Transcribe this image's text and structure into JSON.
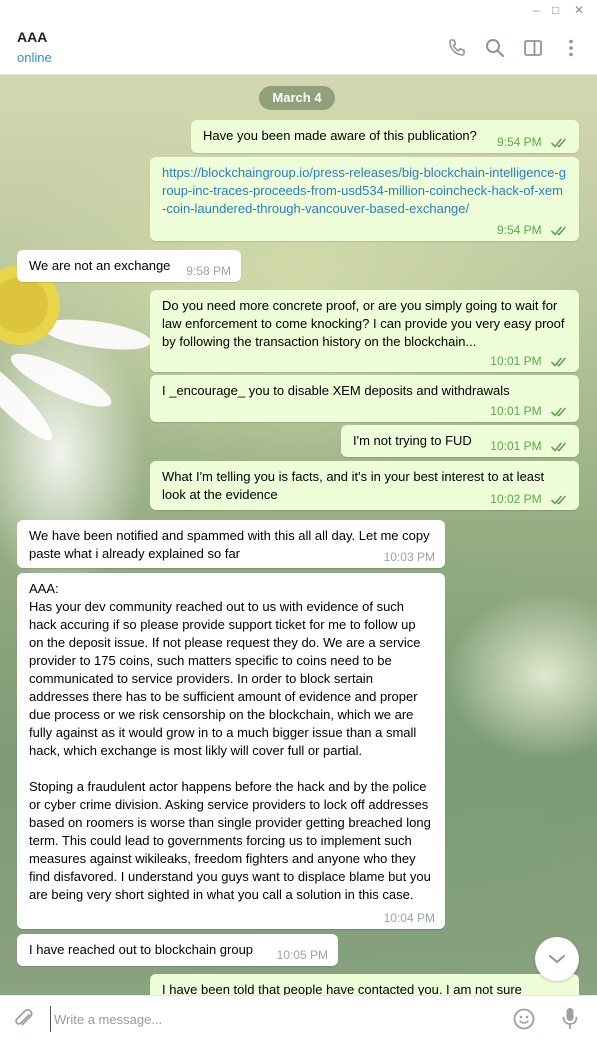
{
  "window": {
    "minimize": "–",
    "maximize": "□",
    "close": "✕"
  },
  "header": {
    "title": "AAA",
    "status": "online",
    "icons": [
      "phone-icon",
      "search-icon",
      "sidebar-toggle-icon",
      "more-icon"
    ]
  },
  "date_separator": "March 4",
  "messages": [
    {
      "from": "me",
      "text": "Have you been made aware of this publication?",
      "time": "9:54 PM",
      "read": true
    },
    {
      "from": "me",
      "text": "https://blockchaingroup.io/press-releases/big-blockchain-intelligence-group-inc-traces-proceeds-from-usd534-million-coincheck-hack-of-xem-coin-laundered-through-vancouver-based-exchange/",
      "time": "9:54 PM",
      "read": true,
      "is_link": true
    },
    {
      "from": "them",
      "text": "We are not an exchange",
      "time": "9:58 PM"
    },
    {
      "from": "me",
      "text": "Do you need more concrete proof, or are you simply going to wait for law enforcement to come knocking? I can provide you very easy proof by following the transaction history on the blockchain...",
      "time": "10:01 PM",
      "read": true
    },
    {
      "from": "me",
      "text": "I _encourage_ you to disable XEM deposits and withdrawals",
      "time": "10:01 PM",
      "read": true
    },
    {
      "from": "me",
      "text": "I'm not trying to FUD",
      "time": "10:01 PM",
      "read": true
    },
    {
      "from": "me",
      "text": "What I'm telling you is facts, and it's in your best interest to at least look at the evidence",
      "time": "10:02 PM",
      "read": true
    },
    {
      "from": "them",
      "text": "We have been notified and spammed with this all all day. Let me copy paste what i already explained so far",
      "time": "10:03 PM"
    },
    {
      "from": "them",
      "text": "AAA:\nHas your dev community reached out to us with evidence of such hack accuring if so please provide support ticket for me to follow up on the deposit issue. If not please request they do. We are a service provider to 175 coins, such matters specific to coins need to be communicated to service providers. In order to block sertain addresses there has to be sufficient amount of evidence and proper due process or we risk censorship on the blockchain, which we are fully against as it would grow in to a much bigger issue than a small hack, which exchange is most likly will cover full or partial.\n\nStoping a fraudulent actor happens before the hack and by the police or cyber crime division. Asking service providers to lock off addresses based on roomers is worse than single provider getting breached long term. This could lead to governments forcing us to implement such measures against wikileaks, freedom fighters and anyone who they find disfavored. I understand you guys want to displace blame but you are being very short sighted in what you call a solution in this case.",
      "time": "10:04 PM"
    },
    {
      "from": "them",
      "text": "I have reached out to blockchain group",
      "time": "10:05 PM"
    },
    {
      "from": "me",
      "text": "I have been told that people have contacted you. I am not sure",
      "time": "",
      "read": false
    }
  ],
  "composer": {
    "placeholder": "Write a message..."
  },
  "colors": {
    "accent": "#2a8fd6",
    "outgoing_bubble": "#eefed8",
    "incoming_bubble": "#ffffff",
    "read_tick": "#5ea84d"
  }
}
